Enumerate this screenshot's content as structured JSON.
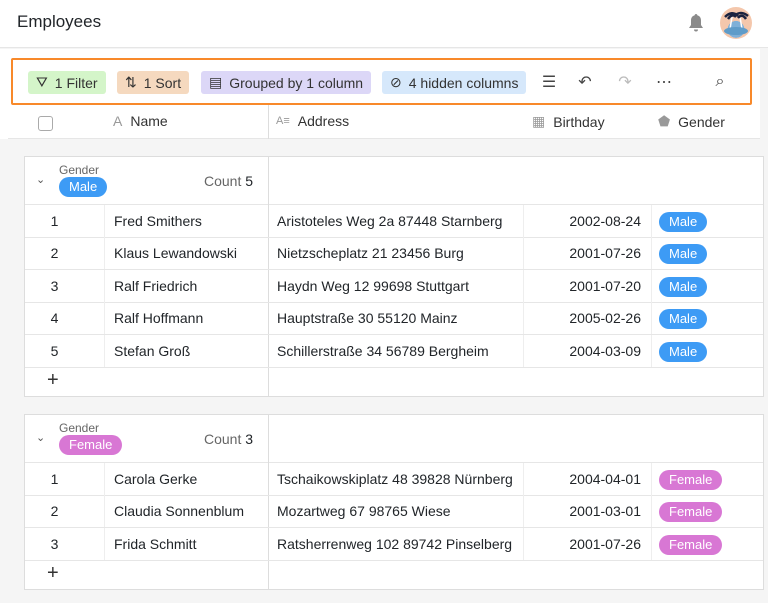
{
  "header": {
    "title": "Employees",
    "bell_icon": "bell-icon",
    "avatar": "user-avatar"
  },
  "toolbar": {
    "filter": "1 Filter",
    "sort": "1 Sort",
    "group": "Grouped by 1 column",
    "hidden": "4 hidden columns"
  },
  "colors": {
    "filter": "#d4f5c9",
    "sort": "#f5d9bf",
    "group": "#dcd7f7",
    "hidden": "#d6e8fb",
    "male": "#3d9bf5",
    "female": "#d877d4",
    "accent": "#f8892a"
  },
  "columns": [
    "Name",
    "Address",
    "Birthday",
    "Gender"
  ],
  "groups": [
    {
      "label": "Gender",
      "value": "Male",
      "count_label": "Count",
      "count": "5",
      "rows": [
        {
          "n": "1",
          "name": "Fred Smithers",
          "address": "Aristoteles Weg 2a 87448 Starnberg",
          "birthday": "2002-08-24",
          "gender": "Male"
        },
        {
          "n": "2",
          "name": "Klaus Lewandowski",
          "address": "Nietzscheplatz 21 23456 Burg",
          "birthday": "2001-07-26",
          "gender": "Male"
        },
        {
          "n": "3",
          "name": "Ralf Friedrich",
          "address": "Haydn Weg 12 99698 Stuttgart",
          "birthday": "2001-07-20",
          "gender": "Male"
        },
        {
          "n": "4",
          "name": "Ralf Hoffmann",
          "address": "Hauptstraße 30 55120 Mainz",
          "birthday": "2005-02-26",
          "gender": "Male"
        },
        {
          "n": "5",
          "name": "Stefan Groß",
          "address": "Schillerstraße 34 56789 Bergheim",
          "birthday": "2004-03-09",
          "gender": "Male"
        }
      ]
    },
    {
      "label": "Gender",
      "value": "Female",
      "count_label": "Count",
      "count": "3",
      "rows": [
        {
          "n": "1",
          "name": "Carola Gerke",
          "address": "Tschaikowskiplatz 48 39828 Nürnberg",
          "birthday": "2004-04-01",
          "gender": "Female"
        },
        {
          "n": "2",
          "name": "Claudia Sonnenblum",
          "address": "Mozartweg 67 98765 Wiese",
          "birthday": "2001-03-01",
          "gender": "Female"
        },
        {
          "n": "3",
          "name": "Frida Schmitt",
          "address": "Ratsherrenweg 102 89742 Pinselberg",
          "birthday": "2001-07-26",
          "gender": "Female"
        }
      ]
    }
  ]
}
